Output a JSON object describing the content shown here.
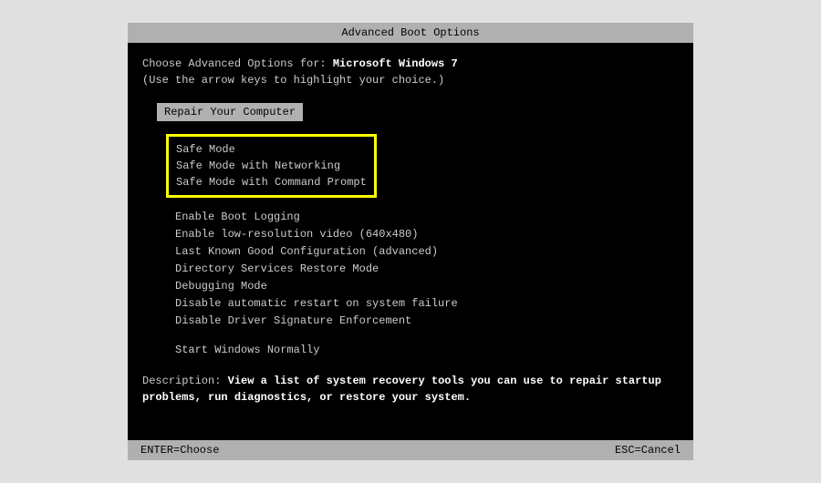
{
  "title": "Advanced Boot Options",
  "choose_prefix": "Choose Advanced Options for: ",
  "os_name": "Microsoft Windows 7",
  "hint": "(Use the arrow keys to highlight your choice.)",
  "selected_option": "Repair Your Computer",
  "safe_modes": [
    "Safe Mode",
    "Safe Mode with Networking",
    "Safe Mode with Command Prompt"
  ],
  "options": [
    "Enable Boot Logging",
    "Enable low-resolution video (640x480)",
    "Last Known Good Configuration (advanced)",
    "Directory Services Restore Mode",
    "Debugging Mode",
    "Disable automatic restart on system failure",
    "Disable Driver Signature Enforcement"
  ],
  "normal_start": "Start Windows Normally",
  "description_label": "Description: ",
  "description_text": "View a list of system recovery tools you can use to repair startup problems, run diagnostics, or restore your system.",
  "footer": {
    "enter": "ENTER=Choose",
    "esc": "ESC=Cancel"
  }
}
